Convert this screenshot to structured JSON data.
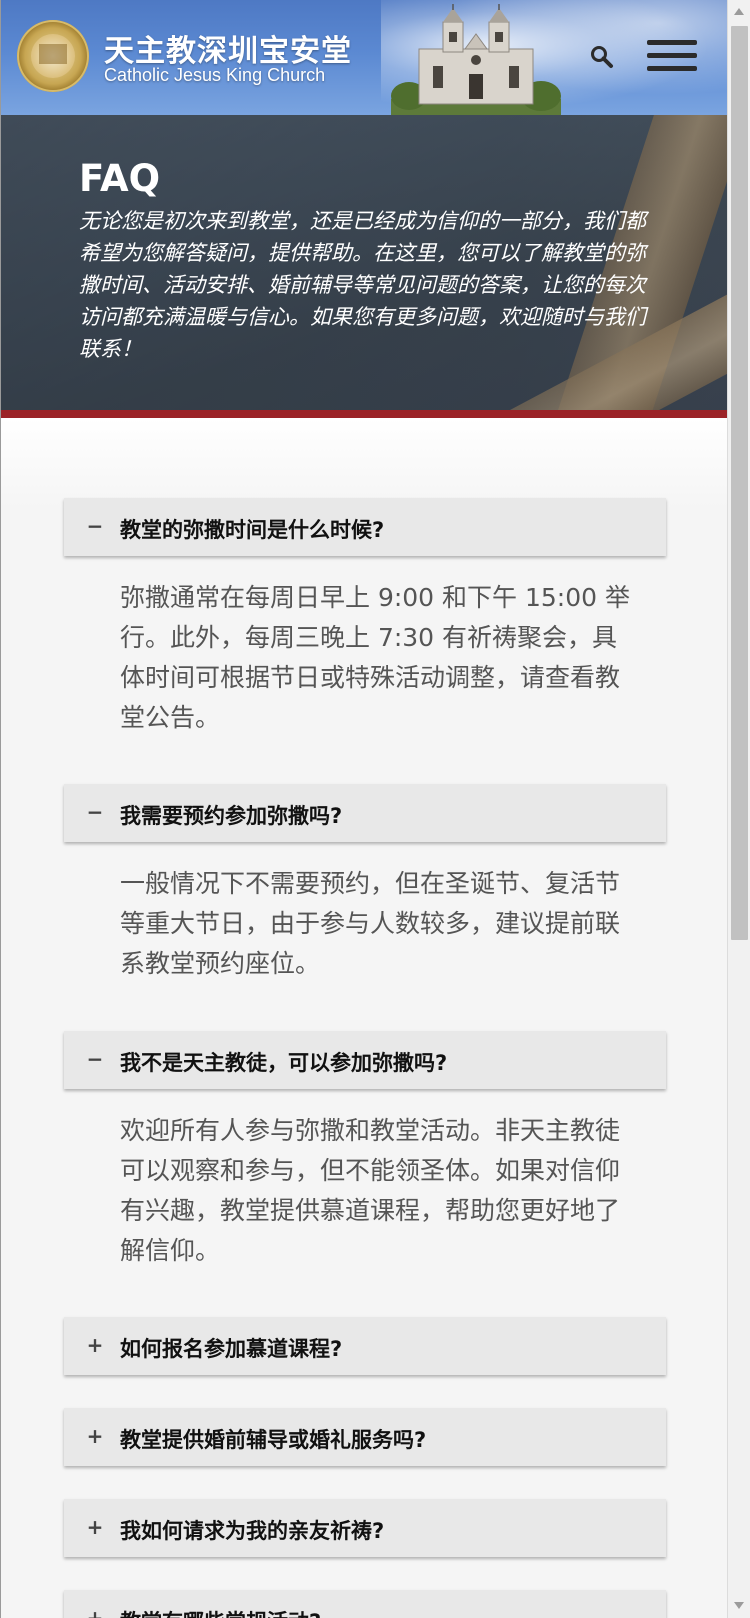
{
  "header": {
    "site_title": "天主教深圳宝安堂",
    "site_subtitle": "Catholic Jesus King Church",
    "logo_icon": "church-seal-logo",
    "search_icon": "search-icon",
    "menu_icon": "hamburger-menu-icon"
  },
  "hero": {
    "title": "FAQ",
    "text": "无论您是初次来到教堂，还是已经成为信仰的一部分，我们都希望为您解答疑问，提供帮助。在这里，您可以了解教堂的弥撒时间、活动安排、婚前辅导等常见问题的答案，让您的每次访问都充满温暖与信心。如果您有更多问题，欢迎随时与我们联系！"
  },
  "faq": [
    {
      "sign": "−",
      "question": "教堂的弥撒时间是什么时候?",
      "answer": "弥撒通常在每周日早上 9:00 和下午 15:00 举行。此外，每周三晚上 7:30 有祈祷聚会，具体时间可根据节日或特殊活动调整，请查看教堂公告。",
      "expanded": true
    },
    {
      "sign": "−",
      "question": "我需要预约参加弥撒吗?",
      "answer": "一般情况下不需要预约，但在圣诞节、复活节等重大节日，由于参与人数较多，建议提前联系教堂预约座位。",
      "expanded": true
    },
    {
      "sign": "−",
      "question": "我不是天主教徒，可以参加弥撒吗?",
      "answer": "欢迎所有人参与弥撒和教堂活动。非天主教徒可以观察和参与，但不能领圣体。如果对信仰有兴趣，教堂提供慕道课程，帮助您更好地了解信仰。",
      "expanded": true
    },
    {
      "sign": "+",
      "question": "如何报名参加慕道课程?",
      "expanded": false
    },
    {
      "sign": "+",
      "question": "教堂提供婚前辅导或婚礼服务吗?",
      "expanded": false
    },
    {
      "sign": "+",
      "question": "我如何请求为我的亲友祈祷?",
      "expanded": false
    },
    {
      "sign": "+",
      "question": "教堂有哪些常规活动?",
      "expanded": false
    }
  ],
  "colors": {
    "header_blue": "#5b89d2",
    "accent_red": "#9b2327",
    "question_bg": "#e8e8e8",
    "answer_text": "#555555"
  }
}
